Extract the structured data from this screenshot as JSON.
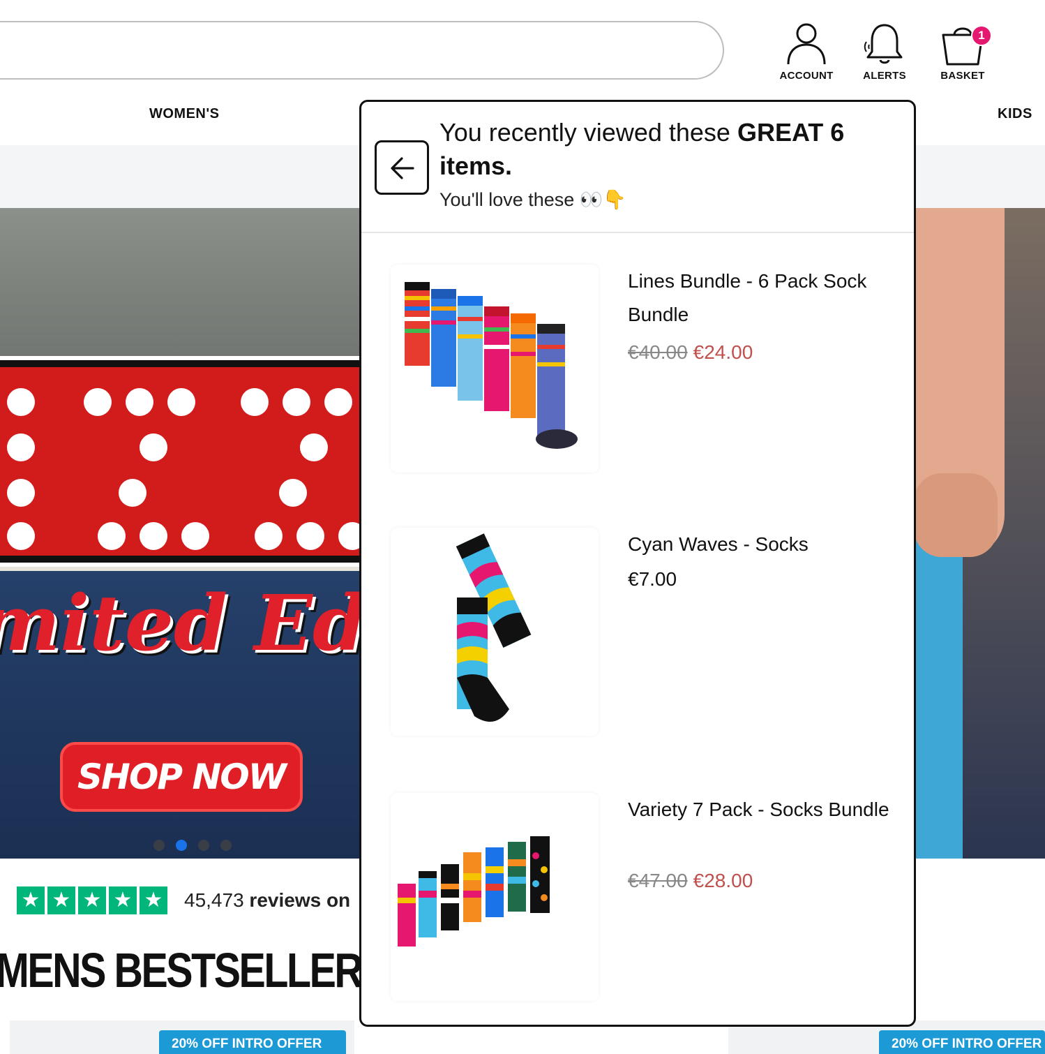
{
  "header": {
    "search_placeholder": "",
    "icons": [
      {
        "name": "account-icon",
        "label": "ACCOUNT"
      },
      {
        "name": "bell-icon",
        "label": "ALERTS"
      },
      {
        "name": "basket-icon",
        "label": "BASKET"
      }
    ],
    "basket_count": "1",
    "badge_color": "#e5176f"
  },
  "nav": {
    "womens": "WOMEN'S",
    "kids": "KIDS"
  },
  "hero": {
    "script_text": "mited Editi",
    "shop_now": "SHOP NOW",
    "slide_count": 4,
    "active_slide": 2,
    "active_dot_color": "#1a73e8"
  },
  "reviews": {
    "star_count": 5,
    "count": "45,473",
    "text_bold": "reviews on",
    "star_color": "#00b67a"
  },
  "section": {
    "title": "MENS BESTSELLERS",
    "offer_label": "20% OFF INTRO OFFER",
    "offer_label_2": "20% OFF INTRO OFFER",
    "offer_color": "#1c9ad6"
  },
  "recently_viewed": {
    "title_prefix": "You recently viewed these ",
    "title_bold": "GREAT 6",
    "title_suffix": "items.",
    "subtitle": "You'll love these 👀👇",
    "items": [
      {
        "name": "Lines Bundle - 6 Pack Sock Bundle",
        "old_price": "€40.00",
        "price": "€24.00",
        "on_sale": true
      },
      {
        "name": "Cyan Waves - Socks",
        "old_price": "",
        "price": "€7.00",
        "on_sale": false
      },
      {
        "name": "Variety 7 Pack - Socks Bundle",
        "old_price": "€47.00",
        "price": "€28.00",
        "on_sale": true
      }
    ],
    "sale_color": "#c0504d"
  }
}
